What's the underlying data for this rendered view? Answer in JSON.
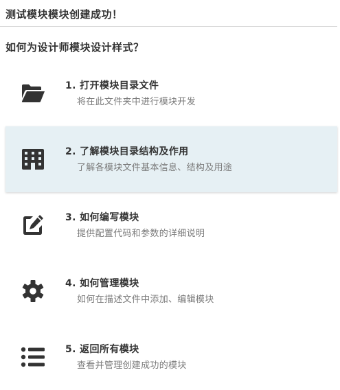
{
  "header": {
    "title": "测试模块模块创建成功！"
  },
  "subtitle": "如何为设计师模块设计样式？",
  "menu": {
    "items": [
      {
        "label": "1. 打开模块目录文件",
        "description": "将在此文件夹中进行模块开发",
        "icon": "folder-open-icon"
      },
      {
        "label": "2. 了解模块目录结构及作用",
        "description": "了解各模块文件基本信息、结构及用途",
        "icon": "building-icon",
        "active": true
      },
      {
        "label": "3. 如何编写模块",
        "description": "提供配置代码和参数的详细说明",
        "icon": "edit-icon"
      },
      {
        "label": "4. 如何管理模块",
        "description": "如何在描述文件中添加、编辑模块",
        "icon": "gear-icon"
      },
      {
        "label": "5. 返回所有模块",
        "description": "查看并管理创建成功的模块",
        "icon": "list-icon"
      }
    ]
  },
  "colors": {
    "icon": "#333333",
    "active_background": "#e6f0f4",
    "description_text": "#7a7a7a"
  }
}
